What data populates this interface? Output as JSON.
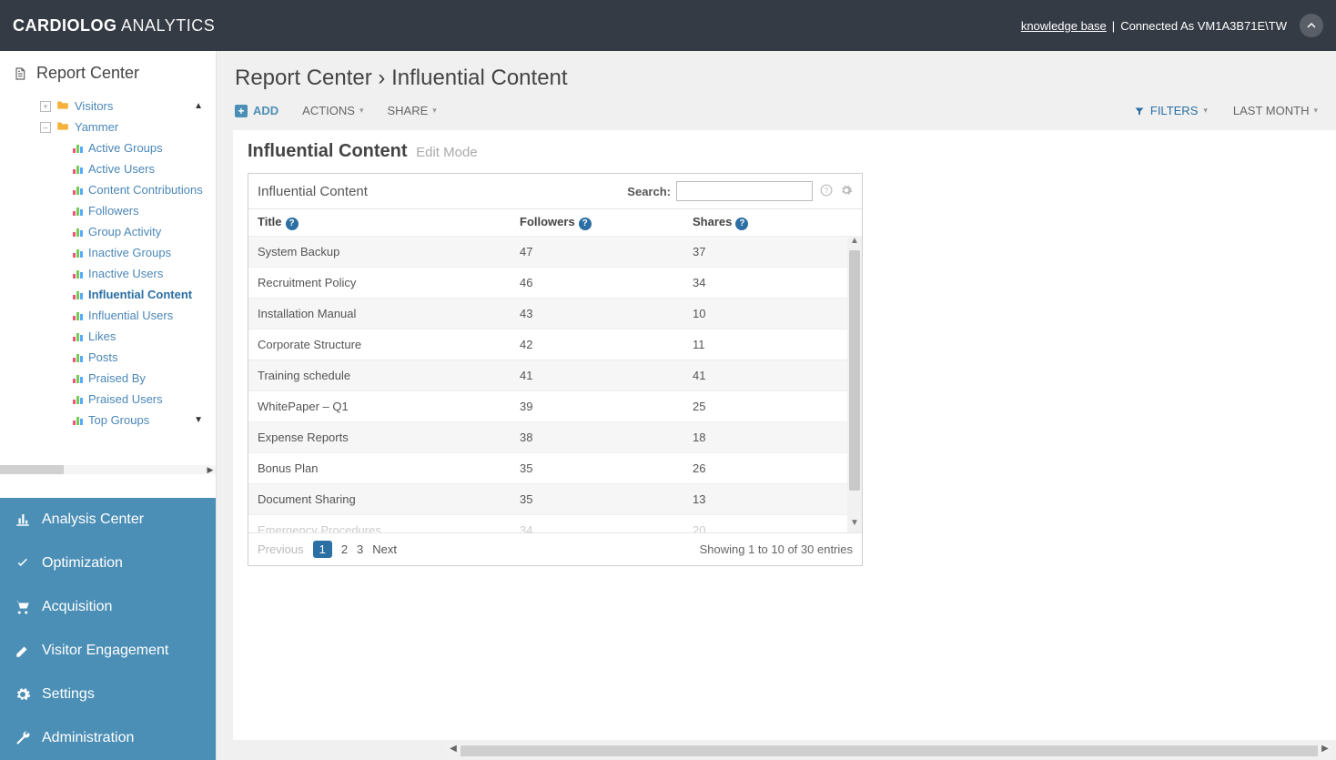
{
  "app": {
    "brand_bold": "CARDIOLOG",
    "brand_light": " ANALYTICS"
  },
  "topbar": {
    "knowledge": "knowledge base",
    "sep": " | ",
    "connected": "Connected As VM1A3B71E\\TW"
  },
  "sidebar": {
    "header": "Report Center",
    "tree": {
      "visitors": "Visitors",
      "yammer": "Yammer",
      "items": [
        "Active Groups",
        "Active Users",
        "Content Contributions",
        "Followers",
        "Group Activity",
        "Inactive Groups",
        "Inactive Users",
        "Influential Content",
        "Influential Users",
        "Likes",
        "Posts",
        "Praised By",
        "Praised Users",
        "Top Groups"
      ],
      "active_index": 7
    },
    "bottom": [
      "Analysis Center",
      "Optimization",
      "Acquisition",
      "Visitor Engagement",
      "Settings",
      "Administration"
    ]
  },
  "breadcrumb": {
    "parent": "Report Center",
    "sep": "  ›  ",
    "current": "Influential Content"
  },
  "toolbar": {
    "add": "ADD",
    "actions": "ACTIONS",
    "share": "SHARE",
    "filters": "FILTERS",
    "last": "LAST MONTH"
  },
  "page": {
    "title": "Influential Content",
    "edit": "Edit Mode"
  },
  "widget": {
    "title": "Influential Content",
    "search_label": "Search:",
    "columns": {
      "title": "Title",
      "followers": "Followers",
      "shares": "Shares"
    },
    "rows": [
      {
        "title": "System Backup",
        "followers": "47",
        "shares": "37"
      },
      {
        "title": "Recruitment Policy",
        "followers": "46",
        "shares": "34"
      },
      {
        "title": "Installation Manual",
        "followers": "43",
        "shares": "10"
      },
      {
        "title": "Corporate Structure",
        "followers": "42",
        "shares": "11"
      },
      {
        "title": "Training schedule",
        "followers": "41",
        "shares": "41"
      },
      {
        "title": "WhitePaper – Q1",
        "followers": "39",
        "shares": "25"
      },
      {
        "title": "Expense Reports",
        "followers": "38",
        "shares": "18"
      },
      {
        "title": "Bonus Plan",
        "followers": "35",
        "shares": "26"
      },
      {
        "title": "Document Sharing",
        "followers": "35",
        "shares": "13"
      }
    ],
    "cutoff": {
      "title": "Emergency Procedures",
      "followers": "34",
      "shares": "20"
    },
    "pager": {
      "prev": "Previous",
      "pages": [
        "1",
        "2",
        "3"
      ],
      "next": "Next",
      "current_index": 0
    },
    "info": "Showing 1 to 10 of 30 entries"
  }
}
